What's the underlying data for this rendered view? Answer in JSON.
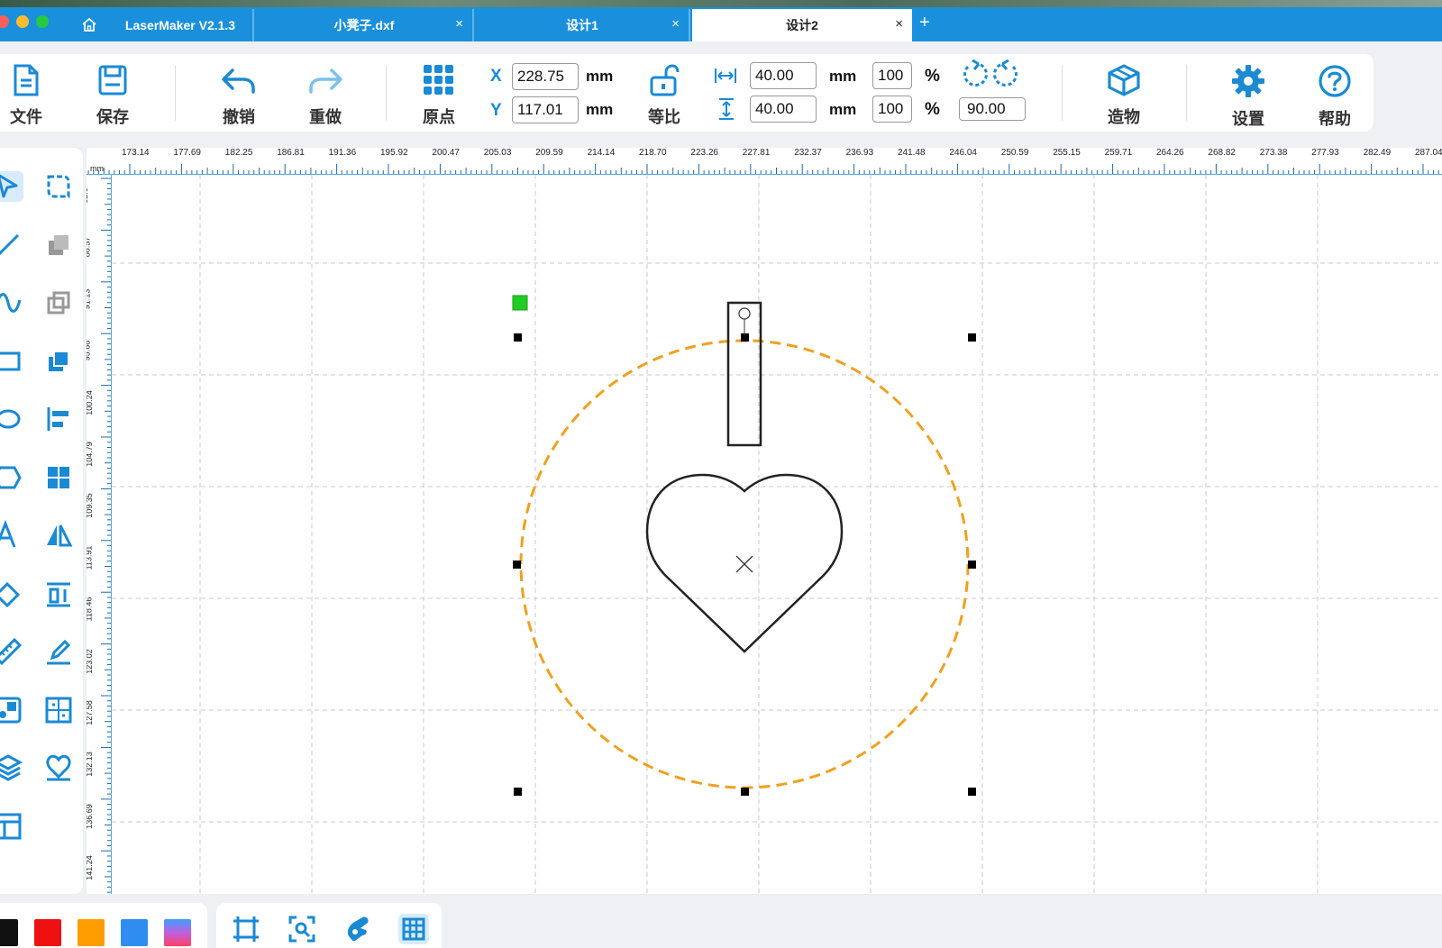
{
  "app": {
    "title": "LaserMaker V2.1.3"
  },
  "tabs": [
    {
      "label": "小凳子.dxf",
      "closable": true,
      "active": false
    },
    {
      "label": "设计1",
      "closable": true,
      "active": false
    },
    {
      "label": "设计2",
      "closable": true,
      "active": true
    }
  ],
  "tab_close_glyph": "×",
  "new_tab_glyph": "+",
  "toolbar": {
    "file": "文件",
    "save": "保存",
    "undo": "撤销",
    "redo": "重做",
    "origin": "原点",
    "lock_ratio": "等比",
    "build": "造物",
    "settings": "设置",
    "help": "帮助",
    "x_label": "X",
    "y_label": "Y",
    "x_value": "228.75",
    "y_value": "117.01",
    "unit": "mm",
    "width_value": "40.00",
    "height_value": "40.00",
    "width_pct": "100",
    "height_pct": "100",
    "pct_symbol": "%",
    "rotation_value": "90.00"
  },
  "ruler": {
    "unit": "mm",
    "h_labels": [
      "173.14",
      "177.69",
      "182.25",
      "186.81",
      "191.36",
      "195.92",
      "200.47",
      "205.03",
      "209.59",
      "214.14",
      "218.70",
      "223.26",
      "227.81",
      "232.37",
      "236.93",
      "241.48",
      "246.04",
      "250.59",
      "255.15",
      "259.71",
      "264.26",
      "268.82",
      "273.38",
      "277.93",
      "282.49",
      "287.04"
    ],
    "v_labels": [
      "82.0",
      "86.57",
      "91.13",
      "95.68",
      "100.24",
      "104.79",
      "109.35",
      "113.91",
      "118.46",
      "123.02",
      "127.58",
      "132.13",
      "136.69",
      "141.24"
    ]
  },
  "left_tools": [
    "select-tool-icon",
    "node-edit-icon",
    "line-tool-icon",
    "group-icon",
    "curve-tool-icon",
    "ungroup-icon",
    "rectangle-tool-icon",
    "combine-icon",
    "ellipse-tool-icon",
    "align-icon",
    "polygon-tool-icon",
    "array-icon",
    "text-tool-icon",
    "mirror-icon",
    "eraser-tool-icon",
    "size-icon",
    "measure-tool-icon",
    "sketch-icon",
    "image-trace-icon",
    "layout-icon",
    "layers-icon",
    "outline-icon",
    "template-icon"
  ],
  "colors": {
    "accent": "#1a8ad4",
    "tabbar": "#1a90dc",
    "selection_circle": "#f0a020",
    "origin_marker": "#22cc22",
    "palette": [
      "#111111",
      "#ee1111",
      "#ff9d00",
      "#2f8cf0",
      "gradient"
    ]
  },
  "bottom_tools": [
    "fit-frame-icon",
    "zoom-selection-icon",
    "pan-icon",
    "grid-icon"
  ]
}
